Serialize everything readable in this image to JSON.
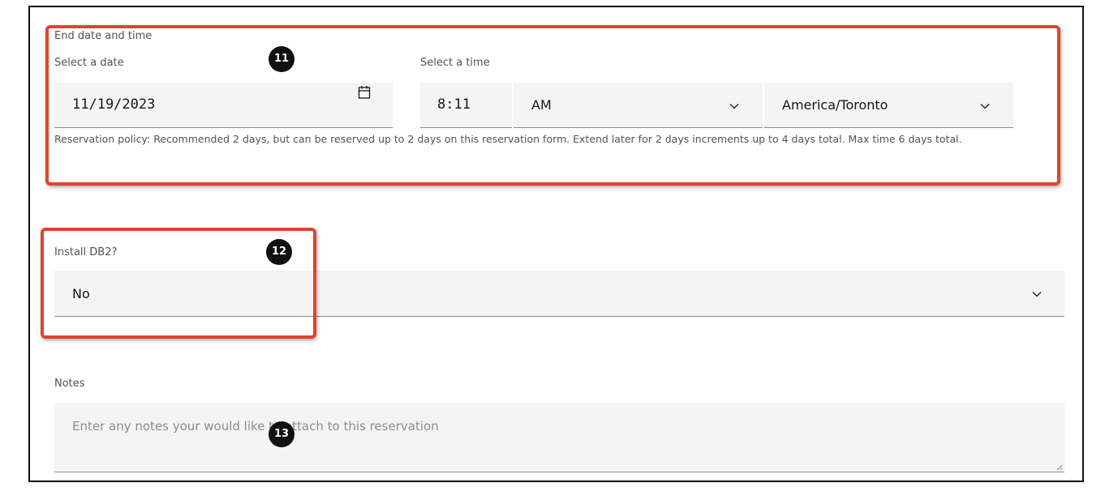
{
  "end_section": {
    "heading": "End date and time",
    "date_label": "Select a date",
    "date_value": "11/19/2023",
    "time_label": "Select a time",
    "time_value": "8:11",
    "ampm_value": "AM",
    "timezone_value": "America/Toronto",
    "policy_text": "Reservation policy: Recommended 2 days, but can be reserved up to 2 days on this reservation form. Extend later for 2 days increments up to 4 days total. Max time 6 days total."
  },
  "db2": {
    "label": "Install DB2?",
    "value": "No"
  },
  "notes": {
    "label": "Notes",
    "placeholder": "Enter any notes your would like to attach to this reservation"
  },
  "annotations": [
    "11",
    "12",
    "13"
  ],
  "icons": {
    "calendar": "calendar-icon",
    "dropdown": "chevron-down-icon"
  },
  "colors": {
    "highlight": "#e0442e",
    "field_bg": "#f4f4f4",
    "badge_bg": "#111111"
  }
}
